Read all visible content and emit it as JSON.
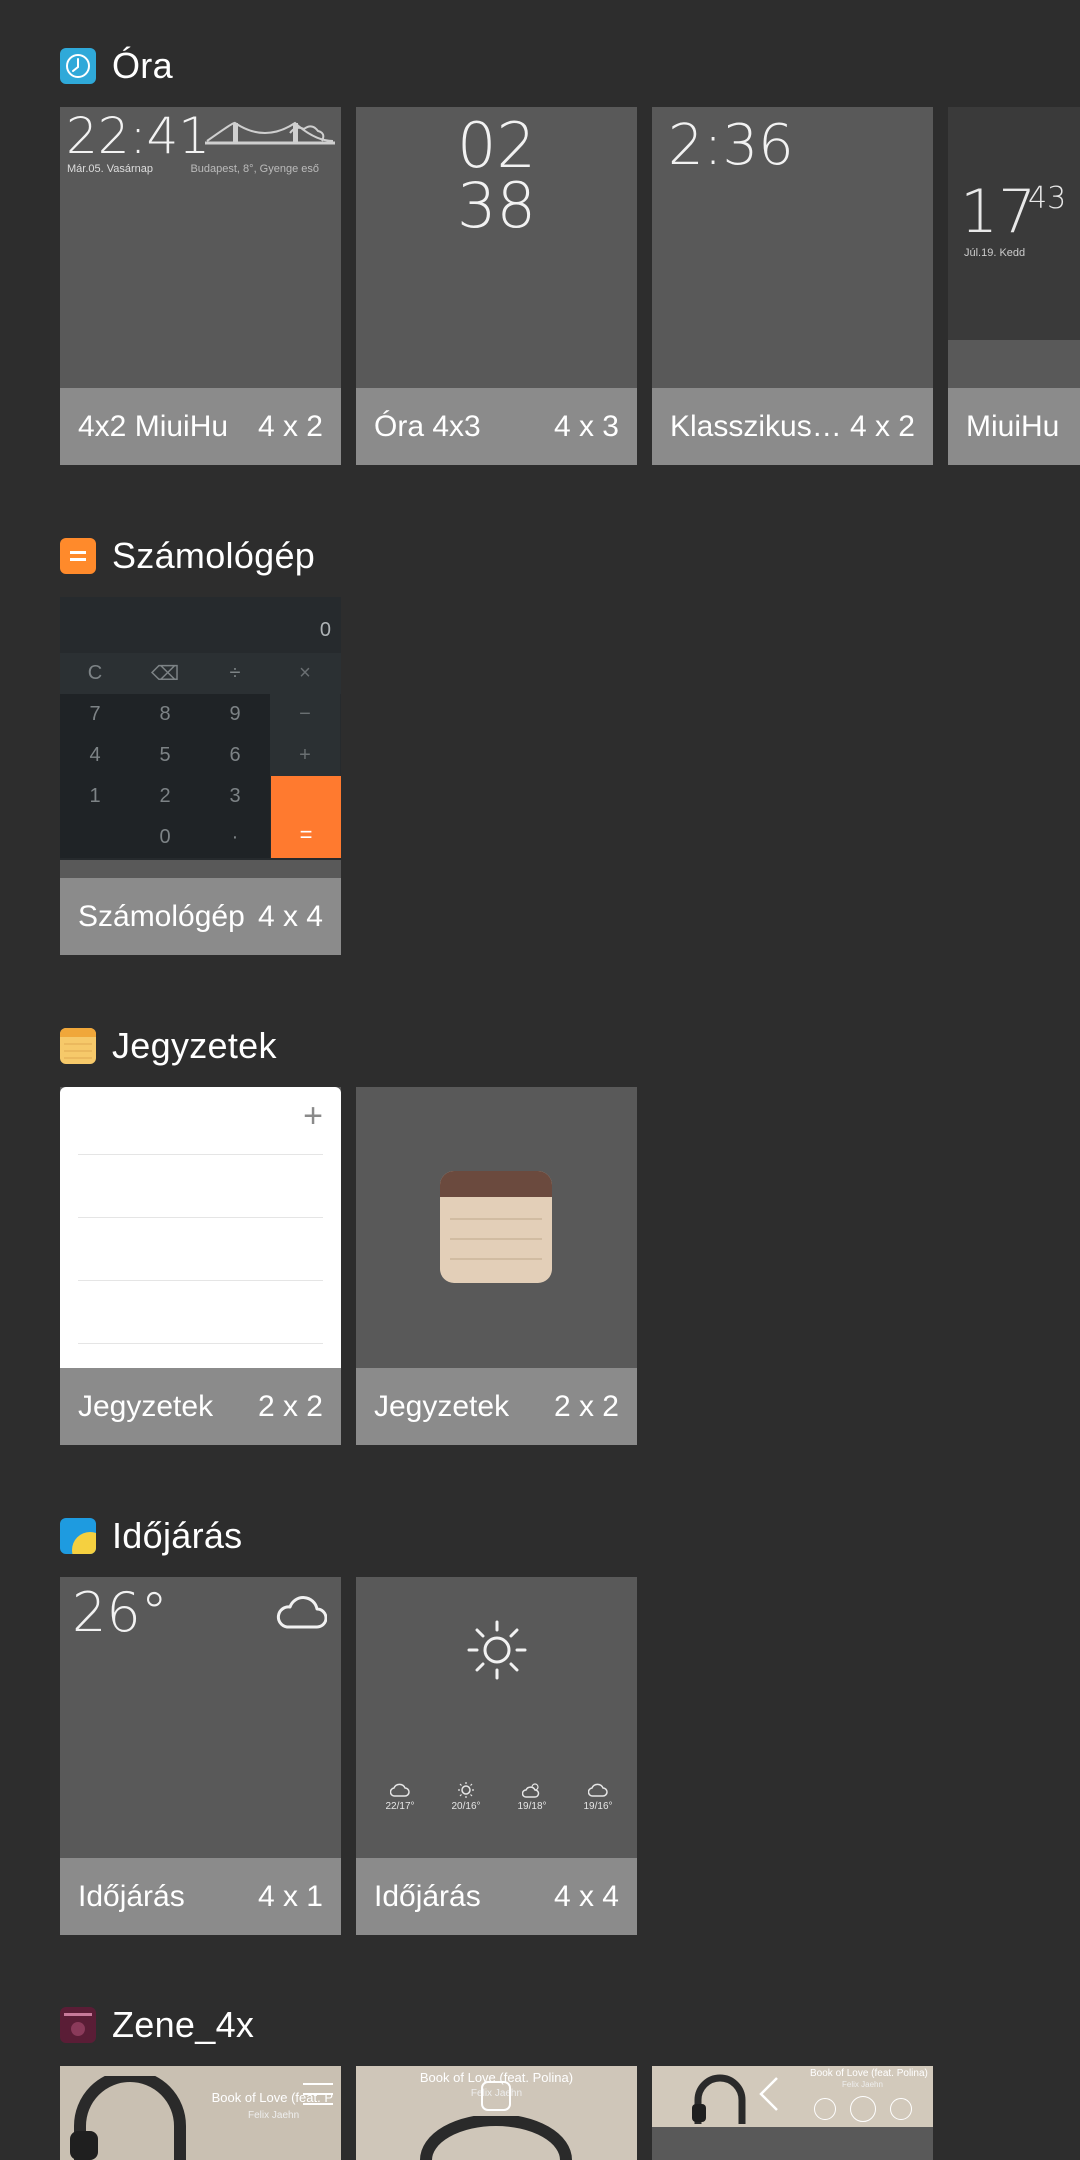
{
  "sections": {
    "ora": {
      "title": "Óra",
      "icon": "clock-icon",
      "widgets": [
        {
          "name": "4x2 MiuiHu",
          "size": "4 x 2",
          "time": "22:41",
          "date": "Már.05. Vasárnap",
          "location": "Budapest, 8°, Gyenge eső"
        },
        {
          "name": "Óra 4x3",
          "size": "4 x 3",
          "hour": "02",
          "minute": "38"
        },
        {
          "name": "Klasszikus…",
          "size": "4 x 2",
          "time": "2:36"
        },
        {
          "name": "MiuiHu",
          "size": "",
          "hour": "17",
          "minute": "43",
          "date": "Júl.19. Kedd"
        }
      ]
    },
    "szamologep": {
      "title": "Számológép",
      "icon": "calculator-icon",
      "widgets": [
        {
          "name": "Számológép",
          "size": "4 x 4",
          "display": "0",
          "keys": [
            [
              "C",
              "⌫",
              "÷",
              "×"
            ],
            [
              "7",
              "8",
              "9",
              "−"
            ],
            [
              "4",
              "5",
              "6",
              "+"
            ],
            [
              "1",
              "2",
              "3",
              ""
            ],
            [
              "",
              "0",
              "·",
              "="
            ]
          ]
        }
      ]
    },
    "jegyzetek": {
      "title": "Jegyzetek",
      "icon": "notes-icon",
      "widgets": [
        {
          "name": "Jegyzetek",
          "size": "2 x 2",
          "add": "+"
        },
        {
          "name": "Jegyzetek",
          "size": "2 x 2"
        }
      ]
    },
    "idojaras": {
      "title": "Időjárás",
      "icon": "weather-icon",
      "widgets": [
        {
          "name": "Időjárás",
          "size": "4 x 1",
          "temp": "26°"
        },
        {
          "name": "Időjárás",
          "size": "4 x 4",
          "forecast": [
            {
              "icon": "cloud-icon",
              "temps": "22/17°"
            },
            {
              "icon": "sun-icon",
              "temps": "20/16°"
            },
            {
              "icon": "cloud-sun-icon",
              "temps": "19/18°"
            },
            {
              "icon": "cloud-icon",
              "temps": "19/16°"
            }
          ]
        }
      ]
    },
    "zene": {
      "title": "Zene_4x",
      "icon": "music-icon",
      "widgets": [
        {
          "song": "Book of Love (feat. P",
          "artist": "Felix Jaehn"
        },
        {
          "song": "Book of Love (feat. Polina)",
          "artist": "Felix Jaehn"
        },
        {
          "song": "Book of Love (feat. Polina)",
          "artist": "Felix Jaehn"
        }
      ]
    }
  },
  "colors": {
    "background": "#2d2d2d",
    "card_footer": "#8b8b8b",
    "card_preview": "#595959",
    "calc_accent": "#ff7a2f"
  }
}
